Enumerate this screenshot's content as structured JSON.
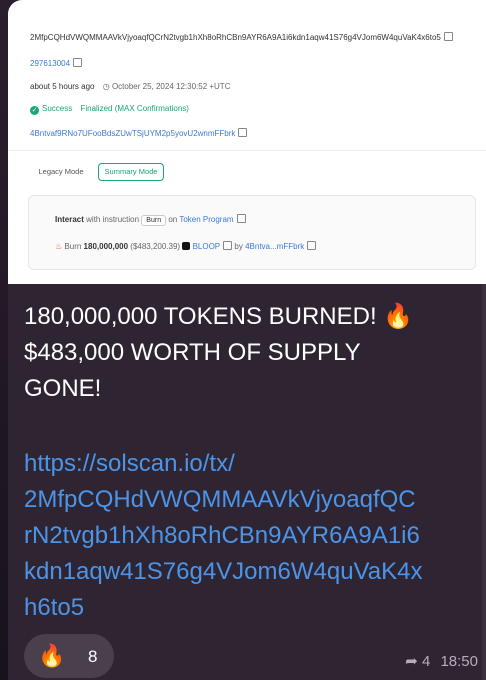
{
  "screenshot": {
    "tx_signature": "2MfpCQHdVWQMMAAVkVjyoaqfQCrN2tvgb1hXh8oRhCBn9AYR6A9A1i6kdn1aqw41S76g4VJom6W4quVaK4x6to5",
    "block": "297613004",
    "age": "about 5 hours ago",
    "timestamp": "October 25, 2024 12:30:52 +UTC",
    "status": "Success",
    "finalized": "Finalized (MAX Confirmations)",
    "signer": "4Bntvaf9RNo7UFooBdsZUwTSjUYM2p5yovU2wnmFFbrk",
    "legacy_mode": "Legacy Mode",
    "summary_mode": "Summary Mode",
    "interact_label": "Interact",
    "with_instruction": "with instruction",
    "instruction_tag": "Burn",
    "on_label": "on",
    "program": "Token Program",
    "burn_label": "Burn",
    "burn_amount": "180,000,000",
    "burn_value": "($483,200.39)",
    "token": "BLOOP",
    "by_label": "by",
    "by_address": "4Bntva...mFFbrk"
  },
  "message": {
    "line1": "180,000,000 TOKENS BURNED! 🔥",
    "line2": "$483,000 WORTH OF SUPPLY",
    "line3": "GONE!",
    "url_lines": [
      "https://solscan.io/tx/",
      "2MfpCQHdVWQMMAAVkVjyoaqfQC",
      "rN2tvgb1hXh8oRhCBn9AYR6A9A1i6",
      "kdn1aqw41S76g4VJom6W4quVaK4x",
      "h6to5"
    ]
  },
  "reaction": {
    "emoji": "🔥",
    "count": "8"
  },
  "meta": {
    "forwards": "4",
    "time": "18:50"
  },
  "icons": [
    "copy-icon",
    "clock-icon",
    "check-icon",
    "burn-icon",
    "token-icon",
    "forward-icon"
  ]
}
